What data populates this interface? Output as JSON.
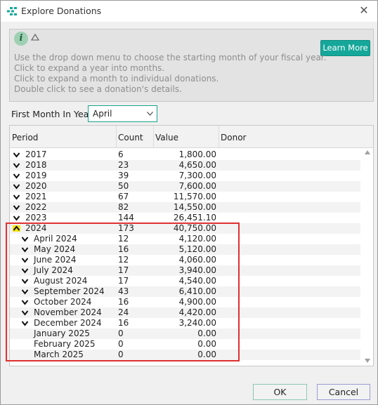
{
  "window": {
    "title": "Explore Donations",
    "app_icon": "grid-icon",
    "close_icon": "close-icon",
    "close_glyph": "✕"
  },
  "info": {
    "icon_letter": "i",
    "learn_more_label": "Learn More",
    "lines": [
      "Use the drop down menu to choose the starting month of your fiscal year.",
      "Click to expand a year into months.",
      "Click to expand a month to individual donations.",
      "Double click to see a donation's details."
    ]
  },
  "first_month": {
    "label": "First Month In Year",
    "selected": "April"
  },
  "table": {
    "columns": [
      "Period",
      "Count",
      "Value",
      "Donor"
    ],
    "rows": [
      {
        "period": "2017",
        "count": "6",
        "value": "1,800.00",
        "level": 0,
        "toggle": "down"
      },
      {
        "period": "2018",
        "count": "23",
        "value": "4,650.00",
        "level": 0,
        "toggle": "down"
      },
      {
        "period": "2019",
        "count": "39",
        "value": "7,300.00",
        "level": 0,
        "toggle": "down"
      },
      {
        "period": "2020",
        "count": "50",
        "value": "7,600.00",
        "level": 0,
        "toggle": "down"
      },
      {
        "period": "2021",
        "count": "67",
        "value": "11,570.00",
        "level": 0,
        "toggle": "down"
      },
      {
        "period": "2022",
        "count": "82",
        "value": "14,550.00",
        "level": 0,
        "toggle": "down"
      },
      {
        "period": "2023",
        "count": "144",
        "value": "26,451.10",
        "level": 0,
        "toggle": "down"
      },
      {
        "period": "2024",
        "count": "173",
        "value": "40,750.00",
        "level": 0,
        "toggle": "up"
      },
      {
        "period": "April 2024",
        "count": "12",
        "value": "4,120.00",
        "level": 1,
        "toggle": "down"
      },
      {
        "period": "May 2024",
        "count": "16",
        "value": "5,120.00",
        "level": 1,
        "toggle": "down"
      },
      {
        "period": "June 2024",
        "count": "12",
        "value": "4,060.00",
        "level": 1,
        "toggle": "down"
      },
      {
        "period": "July 2024",
        "count": "17",
        "value": "3,940.00",
        "level": 1,
        "toggle": "down"
      },
      {
        "period": "August 2024",
        "count": "17",
        "value": "4,540.00",
        "level": 1,
        "toggle": "down"
      },
      {
        "period": "September 2024",
        "count": "43",
        "value": "6,410.00",
        "level": 1,
        "toggle": "down"
      },
      {
        "period": "October 2024",
        "count": "16",
        "value": "4,900.00",
        "level": 1,
        "toggle": "down"
      },
      {
        "period": "November 2024",
        "count": "24",
        "value": "4,420.00",
        "level": 1,
        "toggle": "down"
      },
      {
        "period": "December 2024",
        "count": "16",
        "value": "3,240.00",
        "level": 1,
        "toggle": "down"
      },
      {
        "period": "January 2025",
        "count": "0",
        "value": "0.00",
        "level": 1,
        "toggle": "none"
      },
      {
        "period": "February 2025",
        "count": "0",
        "value": "0.00",
        "level": 1,
        "toggle": "none"
      },
      {
        "period": "March 2025",
        "count": "0",
        "value": "0.00",
        "level": 1,
        "toggle": "none"
      }
    ]
  },
  "buttons": {
    "ok_label": "OK",
    "cancel_label": "Cancel"
  },
  "colors": {
    "accent": "#15a79a",
    "highlight": "#f5e500",
    "annotation": "#e03030"
  }
}
